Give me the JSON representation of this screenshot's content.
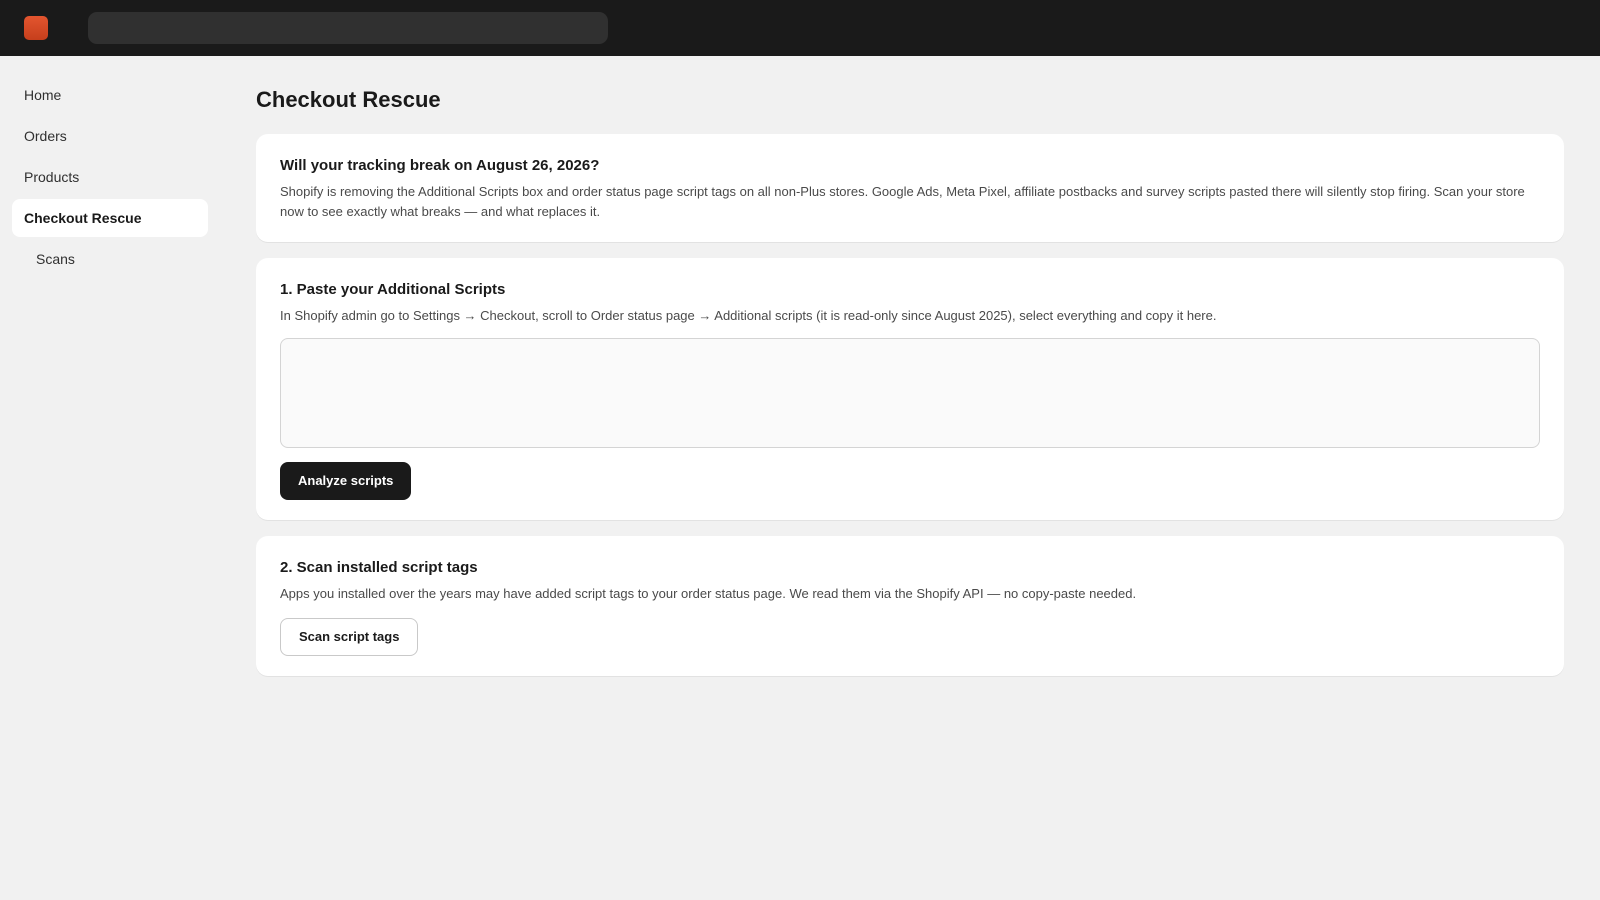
{
  "sidebar": {
    "items": [
      {
        "label": "Home"
      },
      {
        "label": "Orders"
      },
      {
        "label": "Products"
      },
      {
        "label": "Checkout Rescue"
      },
      {
        "label": "Scans"
      }
    ]
  },
  "main": {
    "title": "Checkout Rescue",
    "warning_card": {
      "heading": "Will your tracking break on August 26, 2026?",
      "body": "Shopify is removing the Additional Scripts box and order status page script tags on all non-Plus stores. Google Ads, Meta Pixel, affiliate postbacks and survey scripts pasted there will silently stop firing. Scan your store now to see exactly what breaks — and what replaces it."
    },
    "paste_card": {
      "heading": "1. Paste your Additional Scripts",
      "body": "In Shopify admin go to Settings → Checkout, scroll to Order status page → Additional scripts (it is read-only since August 2025), select everything and copy it here.",
      "textarea_value": "",
      "button_label": "Analyze scripts"
    },
    "scan_card": {
      "heading": "2. Scan installed script tags",
      "body": "Apps you installed over the years may have added script tags to your order status page. We read them via the Shopify API — no copy-paste needed.",
      "button_label": "Scan script tags"
    }
  },
  "colors": {
    "topbar": "#1a1a1a",
    "logo": "#d94a24",
    "background": "#f1f1f1",
    "card": "#ffffff",
    "primary_button": "#1a1a1a"
  }
}
